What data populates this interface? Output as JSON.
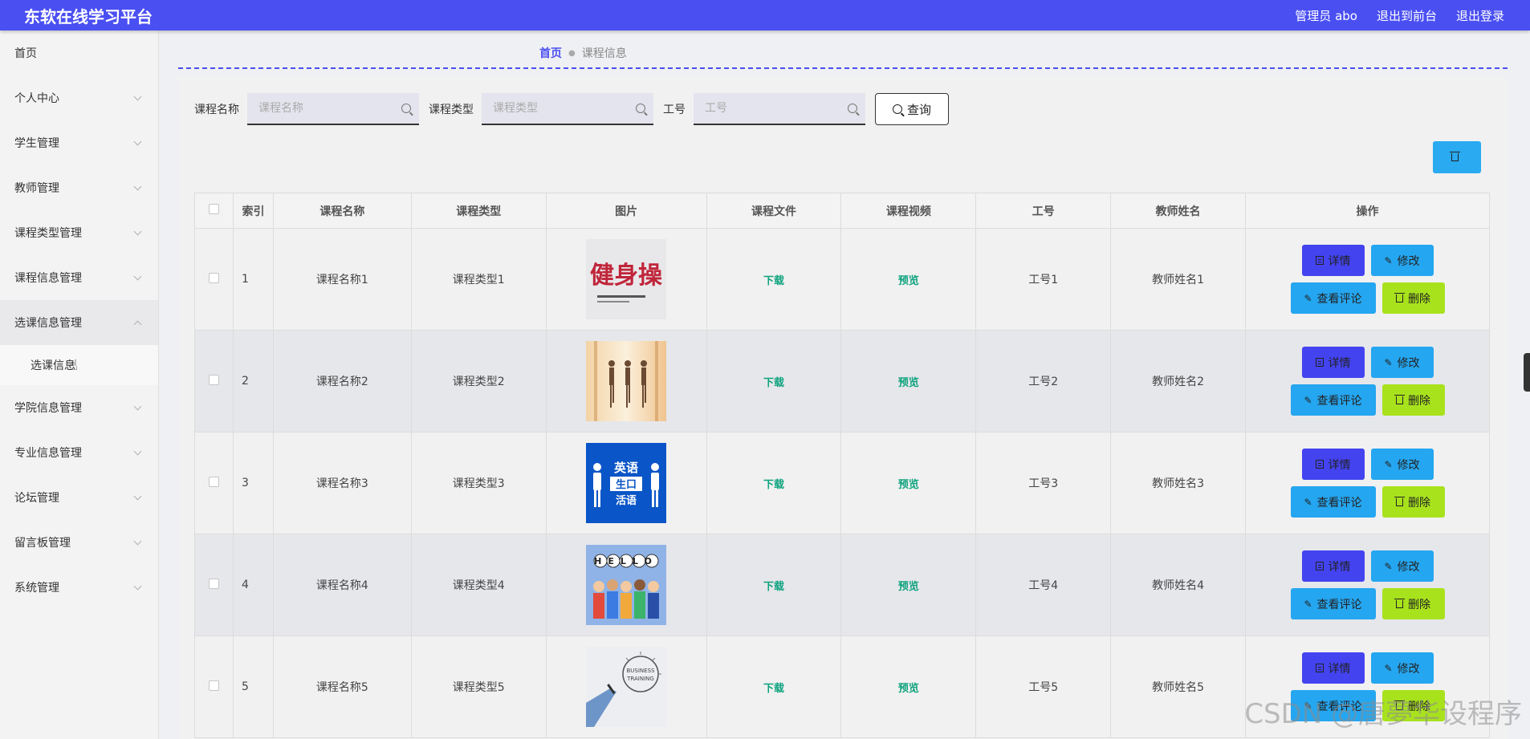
{
  "header": {
    "brand": "东软在线学习平台",
    "user_label": "管理员 abo",
    "front_label": "退出到前台",
    "logout_label": "退出登录"
  },
  "sidebar": {
    "items": [
      {
        "label": "首页"
      },
      {
        "label": "个人中心"
      },
      {
        "label": "学生管理"
      },
      {
        "label": "教师管理"
      },
      {
        "label": "课程类型管理"
      },
      {
        "label": "课程信息管理"
      },
      {
        "label": "选课信息管理"
      },
      {
        "label": "学院信息管理"
      },
      {
        "label": "专业信息管理"
      },
      {
        "label": "论坛管理"
      },
      {
        "label": "留言板管理"
      },
      {
        "label": "系统管理"
      }
    ],
    "sub_item": "选课信息"
  },
  "breadcrumb": {
    "home": "首页",
    "current": "课程信息"
  },
  "search": {
    "course_name_label": "课程名称",
    "course_name_placeholder": "课程名称",
    "course_type_label": "课程类型",
    "course_type_placeholder": "课程类型",
    "job_no_label": "工号",
    "job_no_placeholder": "工号",
    "query_label": "查询"
  },
  "table": {
    "headers": [
      "索引",
      "课程名称",
      "课程类型",
      "图片",
      "课程文件",
      "课程视频",
      "工号",
      "教师姓名",
      "操作"
    ],
    "rows": [
      {
        "index": "1",
        "name": "课程名称1",
        "type": "课程类型1",
        "file": "下载",
        "video": "预览",
        "job_no": "工号1",
        "teacher": "教师姓名1"
      },
      {
        "index": "2",
        "name": "课程名称2",
        "type": "课程类型2",
        "file": "下载",
        "video": "预览",
        "job_no": "工号2",
        "teacher": "教师姓名2"
      },
      {
        "index": "3",
        "name": "课程名称3",
        "type": "课程类型3",
        "file": "下载",
        "video": "预览",
        "job_no": "工号3",
        "teacher": "教师姓名3"
      },
      {
        "index": "4",
        "name": "课程名称4",
        "type": "课程类型4",
        "file": "下载",
        "video": "预览",
        "job_no": "工号4",
        "teacher": "教师姓名4"
      },
      {
        "index": "5",
        "name": "课程名称5",
        "type": "课程类型5",
        "file": "下载",
        "video": "预览",
        "job_no": "工号5",
        "teacher": "教师姓名5"
      }
    ],
    "actions": {
      "detail": "详情",
      "edit": "修改",
      "review": "查看评论",
      "delete": "删除"
    }
  },
  "images": {
    "row1_text": "健身操",
    "row3_text": [
      "英语",
      "生口",
      "活语"
    ],
    "row4_text": "HELLO",
    "row5_text": [
      "BUSINESS",
      "TRAINING"
    ]
  },
  "watermark": "CSDN @唐夢华设程序",
  "colors": {
    "topbar": "#4a4ff2",
    "detail_button": "#4343f0",
    "edit_button": "#25a6f0",
    "delete_button": "#a8e21d",
    "link": "#10a37f"
  }
}
